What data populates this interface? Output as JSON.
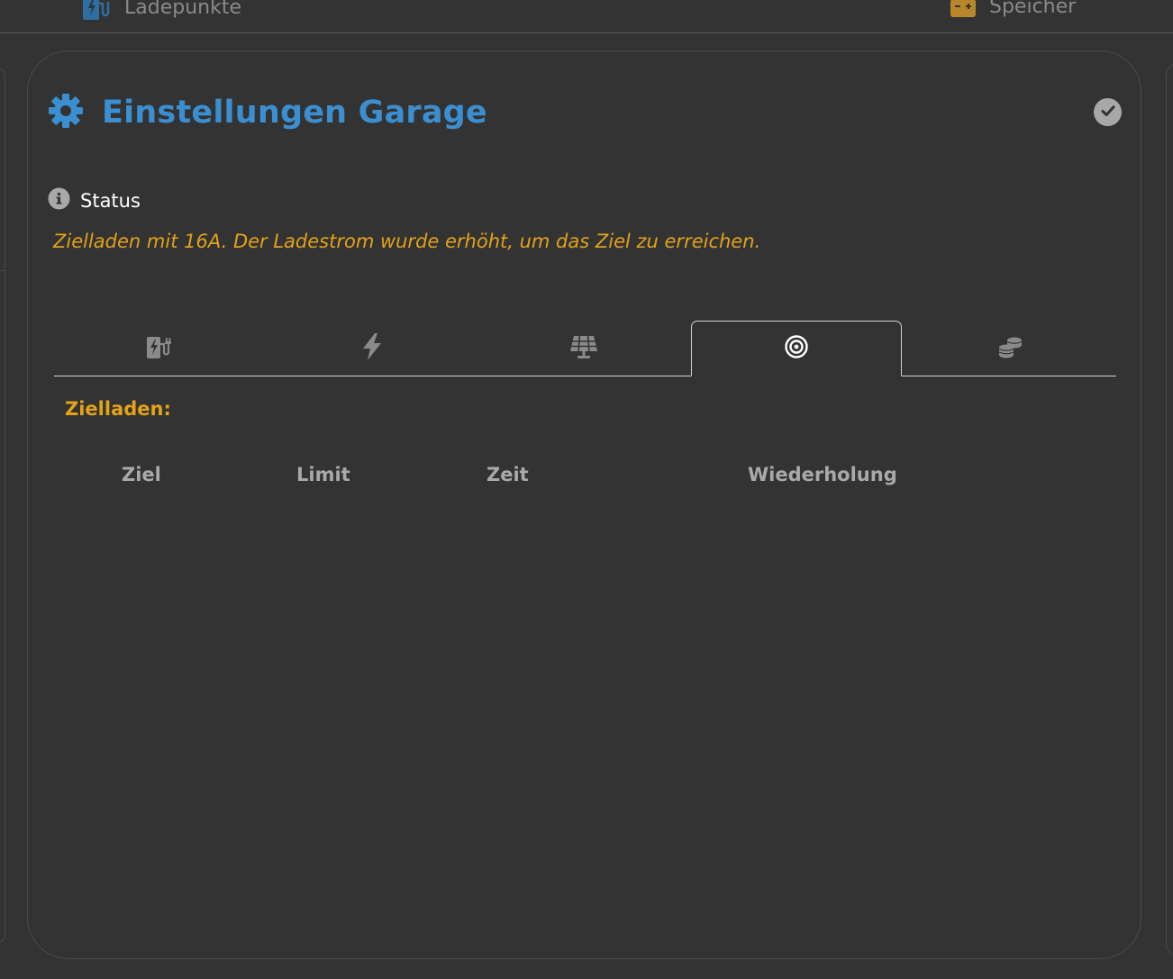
{
  "topnav": {
    "chargepoints_label": "Ladepunkte",
    "storage_label": "Speicher"
  },
  "card": {
    "title": "Einstellungen Garage",
    "status_label": "Status",
    "status_message": "Zielladen mit 16A. Der Ladestrom wurde erhöht, um das Ziel zu erreichen.",
    "section_label": "Zielladen:",
    "tabs": [
      {
        "icon": "charging-station-icon",
        "active": false
      },
      {
        "icon": "bolt-icon",
        "active": false
      },
      {
        "icon": "solar-panel-icon",
        "active": false
      },
      {
        "icon": "target-icon",
        "active": true
      },
      {
        "icon": "coins-icon",
        "active": false
      }
    ],
    "table_headers": [
      "Ziel",
      "Limit",
      "Zeit",
      "Wiederholung"
    ]
  },
  "colors": {
    "background": "#333333",
    "title_blue": "#3b8fd0",
    "accent_orange": "#e3a21a",
    "header_gray": "#a9a9a9",
    "icon_gray": "#8a8a8a"
  }
}
